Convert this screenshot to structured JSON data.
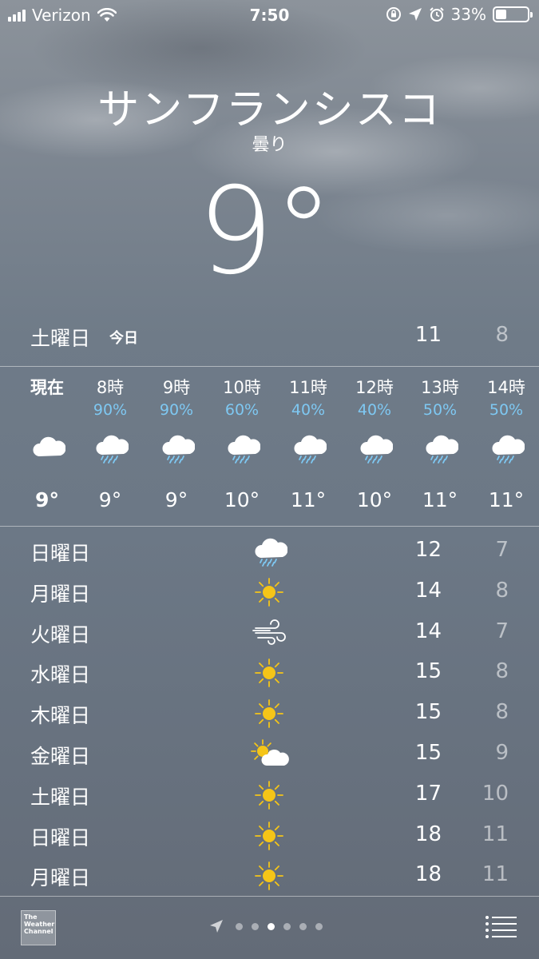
{
  "status_bar": {
    "carrier": "Verizon",
    "time": "7:50",
    "battery": "33%",
    "battery_level": 0.33
  },
  "header": {
    "city": "サンフランシスコ",
    "condition": "曇り",
    "temperature": "9°"
  },
  "today": {
    "day": "土曜日",
    "label": "今日",
    "high": "11",
    "low": "8"
  },
  "hourly": [
    {
      "time": "現在",
      "pop": "",
      "icon": "cloud-icon",
      "temp": "9°",
      "now": true
    },
    {
      "time": "8時",
      "pop": "90%",
      "icon": "rain-icon",
      "temp": "9°"
    },
    {
      "time": "9時",
      "pop": "90%",
      "icon": "rain-icon",
      "temp": "9°"
    },
    {
      "time": "10時",
      "pop": "60%",
      "icon": "rain-icon",
      "temp": "10°"
    },
    {
      "time": "11時",
      "pop": "40%",
      "icon": "rain-icon",
      "temp": "11°"
    },
    {
      "time": "12時",
      "pop": "40%",
      "icon": "rain-icon",
      "temp": "10°"
    },
    {
      "time": "13時",
      "pop": "50%",
      "icon": "rain-icon",
      "temp": "11°"
    },
    {
      "time": "14時",
      "pop": "50%",
      "icon": "rain-icon",
      "temp": "11°"
    }
  ],
  "daily": [
    {
      "day": "日曜日",
      "icon": "rain-icon",
      "high": "12",
      "low": "7"
    },
    {
      "day": "月曜日",
      "icon": "sun-icon",
      "high": "14",
      "low": "8"
    },
    {
      "day": "火曜日",
      "icon": "wind-icon",
      "high": "14",
      "low": "7"
    },
    {
      "day": "水曜日",
      "icon": "sun-icon",
      "high": "15",
      "low": "8"
    },
    {
      "day": "木曜日",
      "icon": "sun-icon",
      "high": "15",
      "low": "8"
    },
    {
      "day": "金曜日",
      "icon": "partly-cloudy-icon",
      "high": "15",
      "low": "9"
    },
    {
      "day": "土曜日",
      "icon": "sun-icon",
      "high": "17",
      "low": "10"
    },
    {
      "day": "日曜日",
      "icon": "sun-icon",
      "high": "18",
      "low": "11"
    },
    {
      "day": "月曜日",
      "icon": "sun-icon",
      "high": "18",
      "low": "11"
    }
  ],
  "footer": {
    "logo_text": "The Weather Channel",
    "page_count": 6,
    "active_page": 2
  },
  "colors": {
    "precip": "#7ec8f2",
    "sun": "#f5c518"
  }
}
